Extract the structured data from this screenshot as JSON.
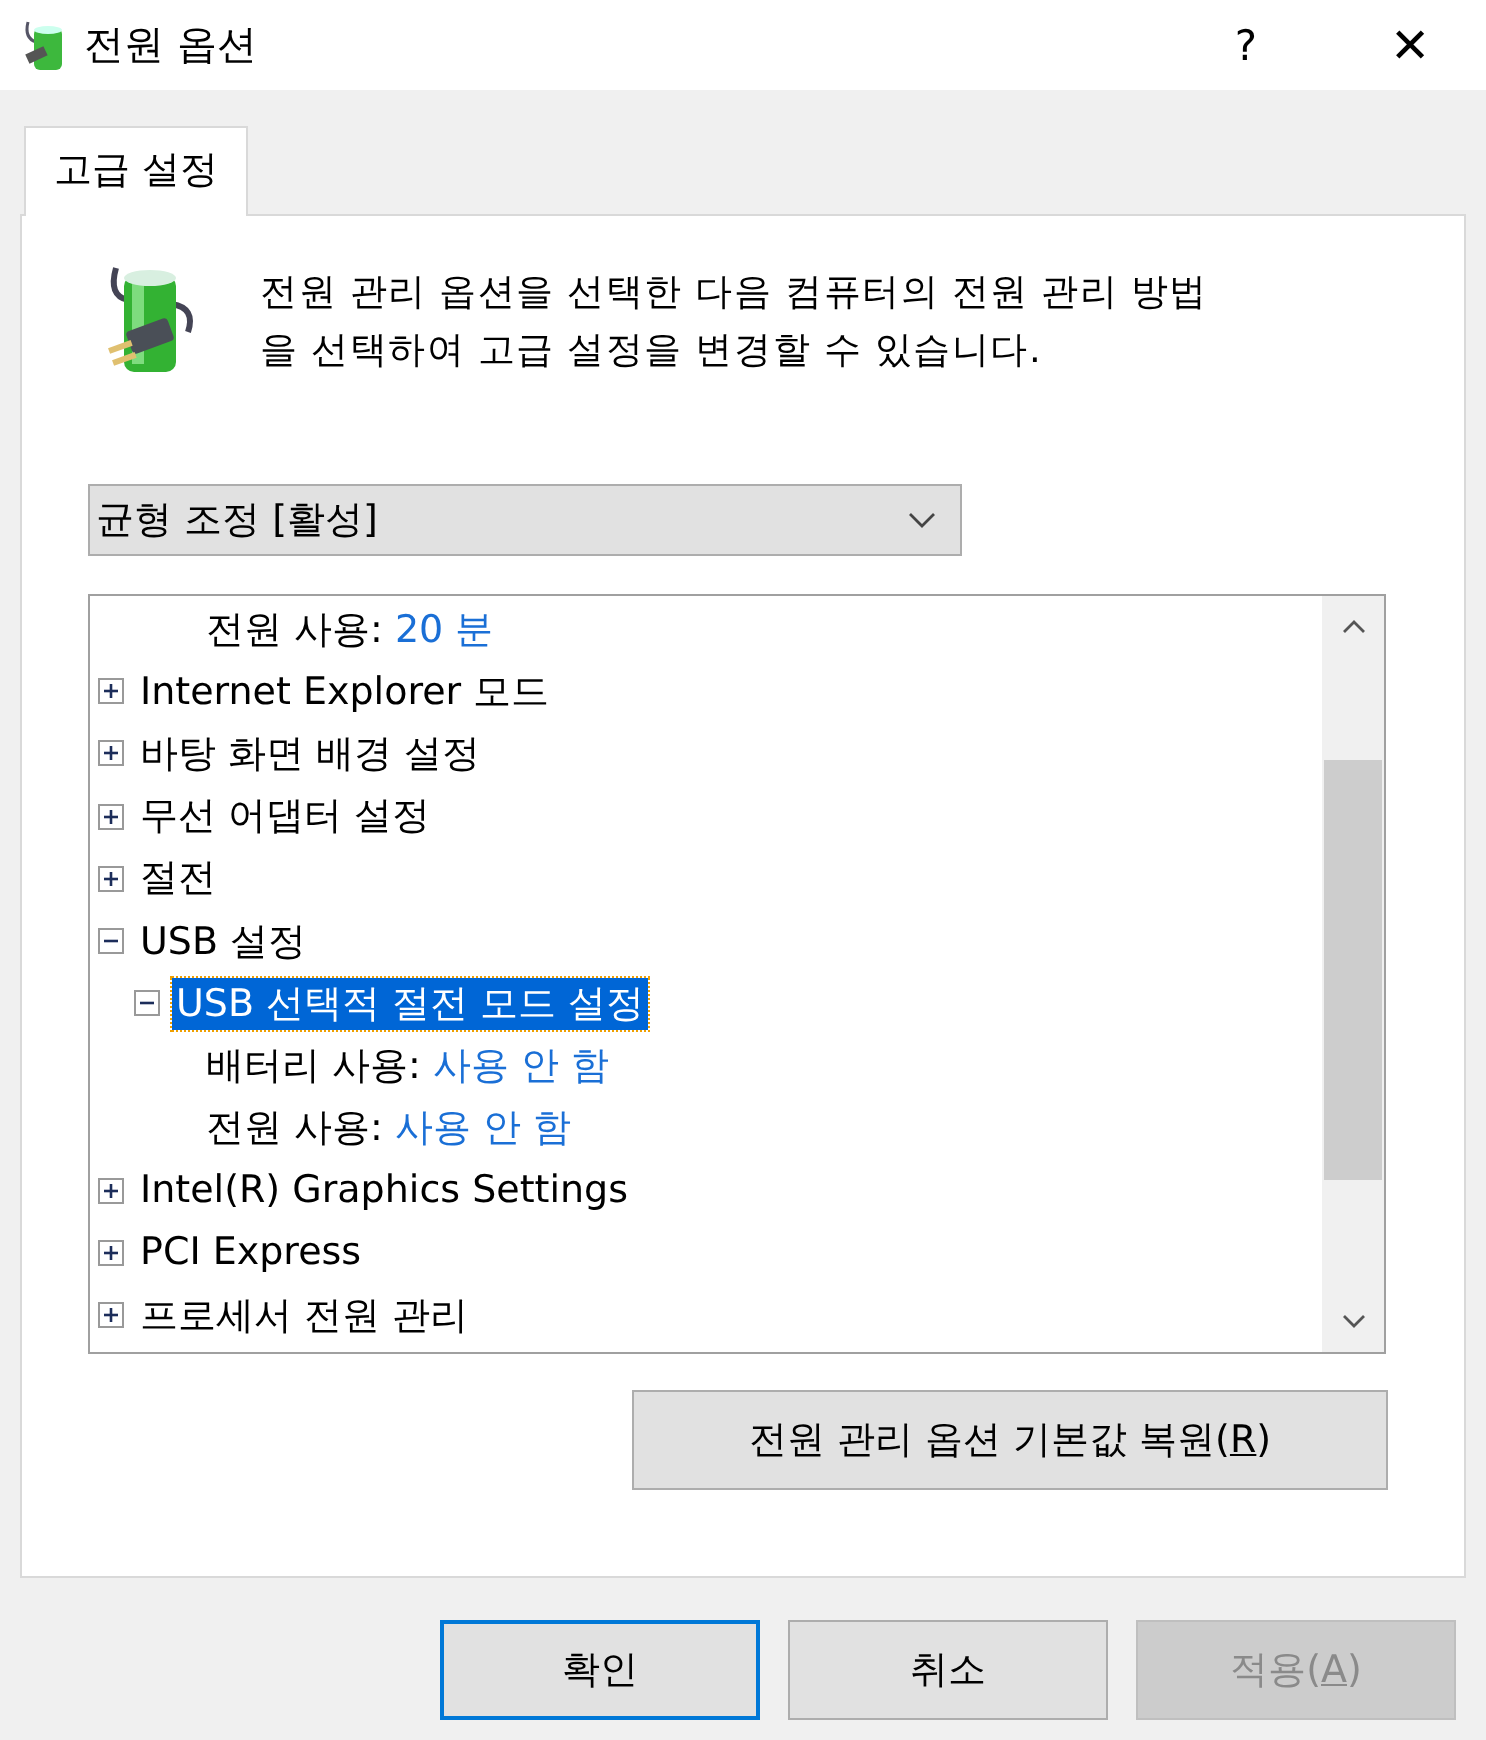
{
  "window": {
    "title": "전원 옵션",
    "help": "?",
    "close": "✕"
  },
  "tabs": [
    {
      "label": "고급 설정",
      "selected": true
    }
  ],
  "description": "전원 관리 옵션을 선택한 다음 컴퓨터의 전원 관리 방법을 선택하여 고급 설정을 변경할 수 있습니다.",
  "plan_dropdown": {
    "value": "균형 조정 [활성]"
  },
  "tree": [
    {
      "kind": "setting",
      "label": "전원 사용:",
      "value": "20 분"
    },
    {
      "kind": "group",
      "label": "Internet Explorer 모드",
      "expanded": false,
      "selected": false
    },
    {
      "kind": "group",
      "label": "바탕 화면 배경 설정",
      "expanded": false,
      "selected": false
    },
    {
      "kind": "group",
      "label": "무선 어댑터 설정",
      "expanded": false,
      "selected": false
    },
    {
      "kind": "group",
      "label": "절전",
      "expanded": false,
      "selected": false
    },
    {
      "kind": "group",
      "label": "USB 설정",
      "expanded": true,
      "selected": false,
      "children": [
        {
          "kind": "group",
          "label": "USB 선택적 절전 모드 설정",
          "expanded": true,
          "selected": true,
          "children": [
            {
              "kind": "setting",
              "label": "배터리 사용:",
              "value": "사용 안 함"
            },
            {
              "kind": "setting",
              "label": "전원 사용:",
              "value": "사용 안 함"
            }
          ]
        }
      ]
    },
    {
      "kind": "group",
      "label": "Intel(R) Graphics Settings",
      "expanded": false,
      "selected": false
    },
    {
      "kind": "group",
      "label": "PCI Express",
      "expanded": false,
      "selected": false
    },
    {
      "kind": "group",
      "label": "프로세서 전원 관리",
      "expanded": false,
      "selected": false
    }
  ],
  "restore_button": {
    "text": "전원 관리 옵션 기본값 복원(",
    "mnemonic": "R",
    "suffix": ")"
  },
  "buttons": [
    {
      "text": "확인",
      "default": true,
      "disabled": false
    },
    {
      "text": "취소",
      "default": false,
      "disabled": false
    },
    {
      "text": "적용(",
      "mnemonic": "A",
      "suffix": ")",
      "default": false,
      "disabled": true
    }
  ]
}
